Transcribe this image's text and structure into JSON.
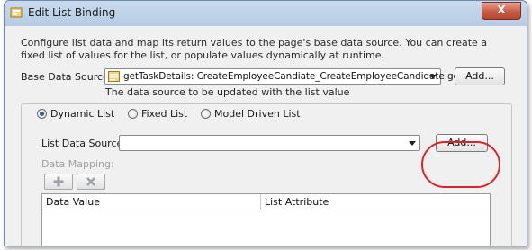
{
  "window": {
    "title": "Edit List Binding",
    "close_label": "X"
  },
  "description": "Configure list data and map its return values to the page's base data source. You can create a fixed list of values for the list, or populate values dynamically at runtime.",
  "base_data_source": {
    "label": "Base Data Source:",
    "value": "getTaskDetails: CreateEmployeeCandiate_CreateEmployeeCandidate.getT...",
    "add_label": "Add...",
    "helper": "The data source to be updated with the list value"
  },
  "list_type": {
    "options": [
      {
        "label": "Dynamic List",
        "selected": true
      },
      {
        "label": "Fixed List",
        "selected": false
      },
      {
        "label": "Model Driven List",
        "selected": false
      }
    ]
  },
  "list_data_source": {
    "label": "List Data Source:",
    "value": "",
    "add_label": "Add..."
  },
  "data_mapping": {
    "label": "Data Mapping:",
    "add_icon": "plus-icon",
    "remove_icon": "x-icon",
    "columns": [
      "Data Value",
      "List Attribute"
    ]
  },
  "colors": {
    "highlight": "#d9252a",
    "title_bar": "#c9daed",
    "close_button": "#c75c43"
  }
}
